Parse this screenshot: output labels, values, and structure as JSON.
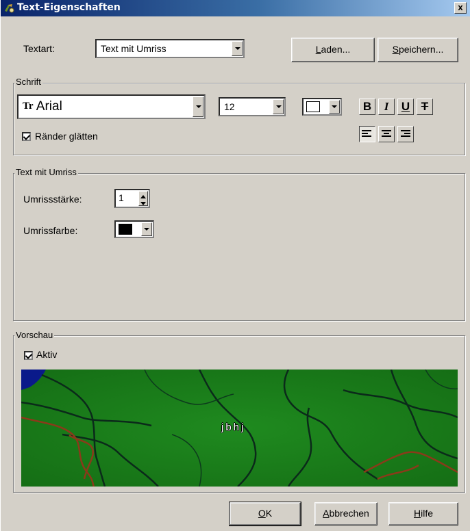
{
  "window": {
    "title": "Text-Eigenschaften",
    "close_symbol": "x"
  },
  "textart": {
    "label": "Textart:",
    "value": "Text mit Umriss"
  },
  "buttons": {
    "load": {
      "first": "L",
      "rest": "aden..."
    },
    "save": {
      "first": "S",
      "rest": "peichern..."
    },
    "ok": {
      "first": "O",
      "rest": "K"
    },
    "cancel": {
      "first": "A",
      "rest": "bbrechen"
    },
    "help": {
      "first": "H",
      "rest": "ilfe"
    }
  },
  "schrift": {
    "legend": "Schrift",
    "font_icon": "Tr",
    "font": "Arial",
    "size": "12",
    "color": "#ffffff",
    "bold": "B",
    "italic": "I",
    "underline": "U",
    "strike": "T",
    "smooth_label": "Ränder glätten",
    "smooth_checked": true,
    "alignment_selected": "left"
  },
  "outline": {
    "legend": "Text mit Umriss",
    "width_label": "Umrissstärke:",
    "width_value": "1",
    "color_label": "Umrissfarbe:",
    "color": "#000000"
  },
  "preview": {
    "legend": "Vorschau",
    "active_label": "Aktiv",
    "active_checked": true,
    "sample_text": "jbhj",
    "map_colors": {
      "land": "#1a7d1a",
      "water": "#0a1a8a",
      "river": "#0b2a1a",
      "road": "#8a3a1a"
    }
  }
}
